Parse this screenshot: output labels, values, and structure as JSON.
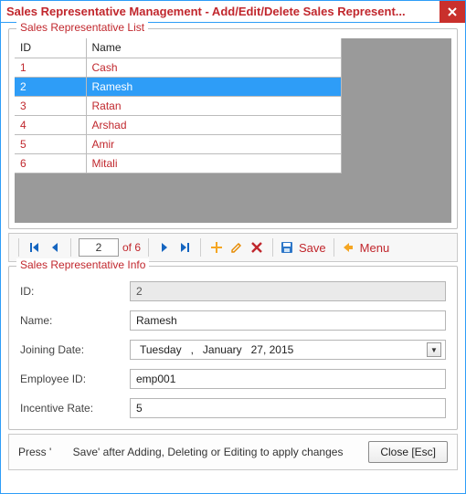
{
  "window": {
    "title": "Sales Representative Management - Add/Edit/Delete Sales Represent..."
  },
  "list_group": {
    "legend": "Sales Representative List",
    "columns": {
      "id": "ID",
      "name": "Name"
    },
    "rows": [
      {
        "id": "1",
        "name": "Cash"
      },
      {
        "id": "2",
        "name": "Ramesh"
      },
      {
        "id": "3",
        "name": "Ratan"
      },
      {
        "id": "4",
        "name": "Arshad"
      },
      {
        "id": "5",
        "name": "Amir"
      },
      {
        "id": "6",
        "name": "Mitali"
      }
    ],
    "selected_index": 1
  },
  "toolbar": {
    "current": "2",
    "total_text": "of 6",
    "save_label": "Save",
    "menu_label": "Menu"
  },
  "info_group": {
    "legend": "Sales Representative Info",
    "labels": {
      "id": "ID:",
      "name": "Name:",
      "joining": "Joining Date:",
      "emp": "Employee ID:",
      "rate": "Incentive Rate:"
    },
    "values": {
      "id": "2",
      "name": "Ramesh",
      "joining": "Tuesday   ,   January   27, 2015",
      "emp": "emp001",
      "rate": "5"
    }
  },
  "footer": {
    "hint": "Press '       Save' after Adding, Deleting or Editing to apply changes",
    "close_label": "Close [Esc]"
  }
}
